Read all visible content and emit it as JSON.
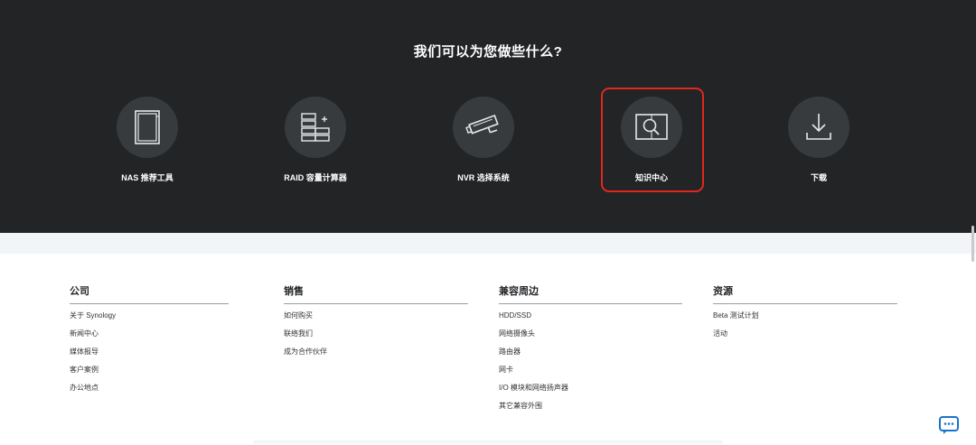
{
  "hero": {
    "heading": "我们可以为您做些什么?",
    "tools": [
      {
        "label": "NAS 推荐工具",
        "icon": "nas-device-icon"
      },
      {
        "label": "RAID 容量计算器",
        "icon": "raid-drives-icon"
      },
      {
        "label": "NVR 选择系统",
        "icon": "security-camera-icon"
      },
      {
        "label": "知识中心",
        "icon": "book-search-icon",
        "selected": true
      },
      {
        "label": "下载",
        "icon": "download-icon"
      }
    ],
    "highlight_color": "#e0281f"
  },
  "footer": {
    "columns": [
      {
        "title": "公司",
        "links": [
          "关于 Synology",
          "新闻中心",
          "媒体报导",
          "客户案例",
          "办公地点"
        ]
      },
      {
        "title": "销售",
        "links": [
          "如何购买",
          "联络我们",
          "成为合作伙伴"
        ]
      },
      {
        "title": "兼容周边",
        "links": [
          "HDD/SSD",
          "网络摄像头",
          "路由器",
          "网卡",
          "I/O 模块和网络扬声器",
          "其它兼容外围"
        ]
      },
      {
        "title": "资源",
        "links": [
          "Beta 测试计划",
          "活动"
        ]
      }
    ]
  },
  "chat": {
    "icon": "chat-bubble-icon",
    "accent": "#1a73c9"
  },
  "colors": {
    "dark_bg": "#222426",
    "icon_circle": "#383b3e",
    "band": "#f2f5f7"
  }
}
